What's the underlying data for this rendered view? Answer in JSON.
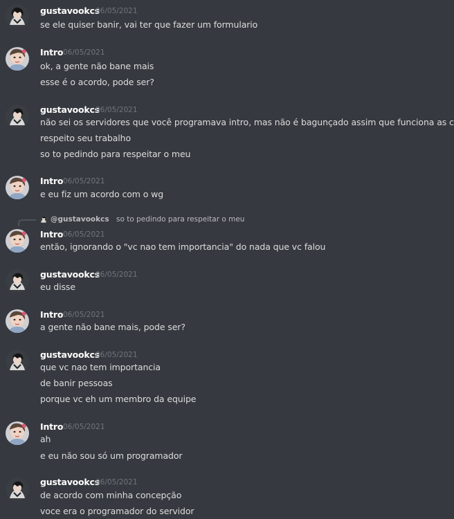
{
  "messages": [
    {
      "author": "gustavookcs",
      "timestamp": "06/05/2021",
      "lines": [
        "se ele quiser banir, vai ter que fazer um formulario"
      ]
    },
    {
      "author": "Intro",
      "timestamp": "06/05/2021",
      "lines": [
        "ok, a gente não bane mais",
        "esse é o acordo, pode ser?"
      ]
    },
    {
      "author": "gustavookcs",
      "timestamp": "06/05/2021",
      "lines": [
        "não sei os servidores que você programava intro, mas não é bagunçado assim que funciona as coisas",
        "respeito seu trabalho",
        "so to pedindo para respeitar o meu"
      ]
    },
    {
      "author": "Intro",
      "timestamp": "06/05/2021",
      "lines": [
        "e eu fiz um acordo com o wg"
      ]
    },
    {
      "author": "Intro",
      "timestamp": "06/05/2021",
      "lines": [
        "então, ignorando o \"vc nao tem importancia\" do nada que vc falou"
      ]
    },
    {
      "author": "gustavookcs",
      "timestamp": "06/05/2021",
      "lines": [
        "eu disse"
      ]
    },
    {
      "author": "Intro",
      "timestamp": "06/05/2021",
      "lines": [
        "a gente não bane mais, pode ser?"
      ]
    },
    {
      "author": "gustavookcs",
      "timestamp": "06/05/2021",
      "lines": [
        "que vc nao tem importancia",
        "de banir pessoas",
        "porque vc eh um membro da equipe"
      ]
    },
    {
      "author": "Intro",
      "timestamp": "06/05/2021",
      "lines": [
        "ah",
        "e eu não sou só um programador"
      ]
    },
    {
      "author": "gustavookcs",
      "timestamp": "06/05/2021",
      "lines": [
        "de acordo com minha concepção",
        "voce era o programador do servidor"
      ]
    }
  ],
  "reply": {
    "mention": "@gustavookcs",
    "text": "so to pedindo para respeitar o meu"
  },
  "colors": {
    "background": "#36393f",
    "username": "#ffffff",
    "text": "#dcddde",
    "timestamp": "#72767d"
  }
}
